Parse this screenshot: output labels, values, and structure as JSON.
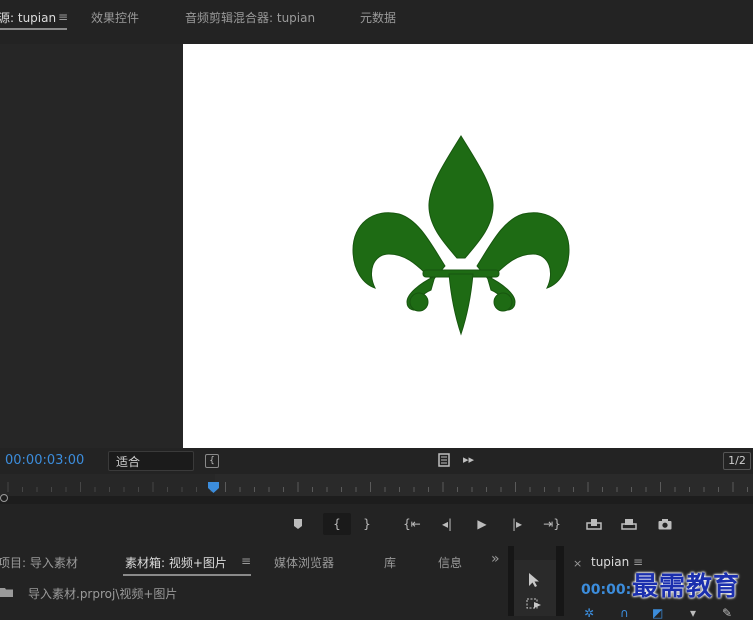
{
  "top_tabs": {
    "source": {
      "prefix": "源",
      "name": ": tupian"
    },
    "effects": "效果控件",
    "mixer": "音频剪辑混合器: tupian",
    "metadata": "元数据",
    "menu": "≡"
  },
  "controls": {
    "timecode": "00:00:03:00",
    "fit_select": "适合",
    "ratio": "1/2"
  },
  "bottom_tabs": {
    "project": "项目: 导入素材",
    "bin": "素材箱: 视频+图片",
    "bin_menu": "≡",
    "media_browser": "媒体浏览器",
    "library": "库",
    "info": "信息",
    "more": "»",
    "path": "导入素材.prproj\\视频+图片"
  },
  "sequence": {
    "close": "×",
    "name": "tupian",
    "menu": "≡",
    "timecode": "00:00:"
  },
  "watermark": "最需教育",
  "colors": {
    "accent_blue": "#3c8ddc",
    "logo_green": "#1e6b14",
    "panel_bg": "#232323"
  }
}
